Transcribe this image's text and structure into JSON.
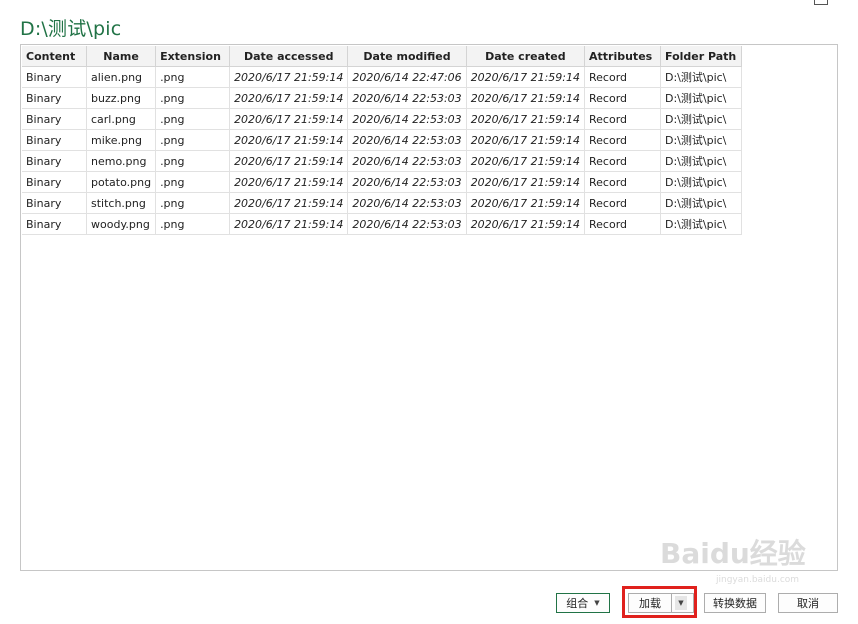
{
  "window": {
    "title": "D:\\测试\\pic"
  },
  "table": {
    "columns": [
      "Content",
      "Name",
      "Extension",
      "Date accessed",
      "Date modified",
      "Date created",
      "Attributes",
      "Folder Path"
    ],
    "rows": [
      [
        "Binary",
        "alien.png",
        ".png",
        "2020/6/17 21:59:14",
        "2020/6/14 22:47:06",
        "2020/6/17 21:59:14",
        "Record",
        "D:\\测试\\pic\\"
      ],
      [
        "Binary",
        "buzz.png",
        ".png",
        "2020/6/17 21:59:14",
        "2020/6/14 22:53:03",
        "2020/6/17 21:59:14",
        "Record",
        "D:\\测试\\pic\\"
      ],
      [
        "Binary",
        "carl.png",
        ".png",
        "2020/6/17 21:59:14",
        "2020/6/14 22:53:03",
        "2020/6/17 21:59:14",
        "Record",
        "D:\\测试\\pic\\"
      ],
      [
        "Binary",
        "mike.png",
        ".png",
        "2020/6/17 21:59:14",
        "2020/6/14 22:53:03",
        "2020/6/17 21:59:14",
        "Record",
        "D:\\测试\\pic\\"
      ],
      [
        "Binary",
        "nemo.png",
        ".png",
        "2020/6/17 21:59:14",
        "2020/6/14 22:53:03",
        "2020/6/17 21:59:14",
        "Record",
        "D:\\测试\\pic\\"
      ],
      [
        "Binary",
        "potato.png",
        ".png",
        "2020/6/17 21:59:14",
        "2020/6/14 22:53:03",
        "2020/6/17 21:59:14",
        "Record",
        "D:\\测试\\pic\\"
      ],
      [
        "Binary",
        "stitch.png",
        ".png",
        "2020/6/17 21:59:14",
        "2020/6/14 22:53:03",
        "2020/6/17 21:59:14",
        "Record",
        "D:\\测试\\pic\\"
      ],
      [
        "Binary",
        "woody.png",
        ".png",
        "2020/6/17 21:59:14",
        "2020/6/14 22:53:03",
        "2020/6/17 21:59:14",
        "Record",
        "D:\\测试\\pic\\"
      ]
    ]
  },
  "buttons": {
    "combine": "组合",
    "load": "加载",
    "transform": "转换数据",
    "cancel": "取消"
  },
  "icons": {
    "dropdown": "chevron-down-icon",
    "maximize": "maximize-icon"
  },
  "watermark": {
    "text": "Baidu经验",
    "url": "jingyan.baidu.com"
  },
  "colors": {
    "title": "#217346",
    "highlight": "#e0211d"
  }
}
